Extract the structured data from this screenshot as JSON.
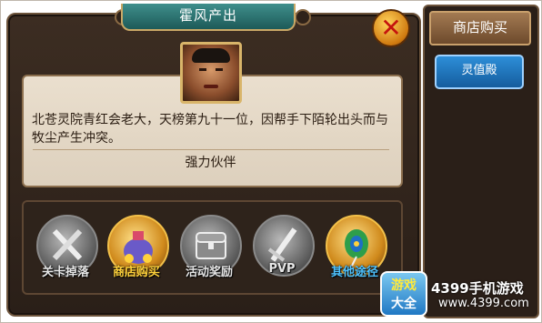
{
  "title": "霍风产出",
  "character": {
    "description": "北苍灵院青红会老大，天榜第九十一位，因帮手下陌轮出头而与牧尘产生冲突。",
    "bond": "强力伙伴"
  },
  "close_icon": "close-icon",
  "sources": [
    {
      "label": "关卡掉落",
      "icon": "crossed-swords-icon",
      "color": "#e6e6e6",
      "active": false
    },
    {
      "label": "商店购买",
      "icon": "treasure-bag-icon",
      "color": "#ffd23c",
      "active": true
    },
    {
      "label": "活动奖励",
      "icon": "chest-icon",
      "color": "#e6e6e6",
      "active": false
    },
    {
      "label": "PVP",
      "icon": "sword-icon",
      "color": "#e6e6e6",
      "active": false
    },
    {
      "label": "其他途径",
      "icon": "peacock-feather-icon",
      "color": "#4fc3ff",
      "active": true
    }
  ],
  "side": {
    "tab": "商店购买",
    "shop": "灵值殿"
  },
  "watermark": {
    "logo_line1": "游戏",
    "logo_line2": "大全",
    "brand": "4399手机游戏",
    "url": "www.4399.com"
  },
  "colors": {
    "accent": "#c9a866",
    "panel": "#2e231b",
    "highlight_gold": "#ffd23c",
    "highlight_blue": "#4fc3ff",
    "shop_button": "#2d8ed8"
  }
}
